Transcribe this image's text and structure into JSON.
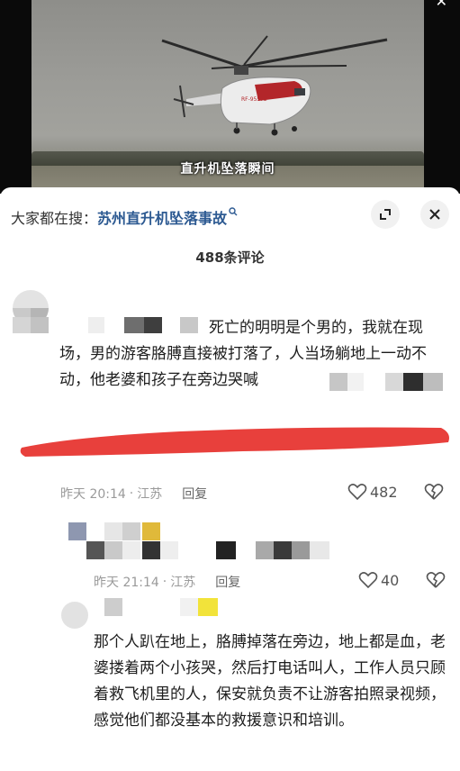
{
  "video": {
    "caption": "直升机坠落瞬间",
    "helicopter_marking": "RF-95572"
  },
  "search": {
    "label": "大家都在搜：",
    "term": "苏州直升机坠落事故"
  },
  "comments_header": {
    "count_label": "488条评论"
  },
  "comments": [
    {
      "text": "死亡的明明是个男的，我就在现场，男的游客胳膊直接被打落了，人当场躺地上一动不动，他老婆和孩子在旁边哭喊",
      "time": "昨天 20:14",
      "location": "江苏",
      "reply_label": "回复",
      "likes": "482"
    },
    {
      "time": "昨天 21:14",
      "location": "江苏",
      "reply_label": "回复",
      "likes": "40"
    },
    {
      "text": "那个人趴在地上，胳膊掉落在旁边，地上都是血，老婆搂着两个小孩哭，然后打电话叫人，工作人员只顾着救飞机里的人，保安就负责不让游客拍照录视频，感觉他们都没基本的救援意识和培训。"
    }
  ],
  "colors": {
    "search_term": "#2d5a92",
    "redact_mark": "#e8403c"
  }
}
